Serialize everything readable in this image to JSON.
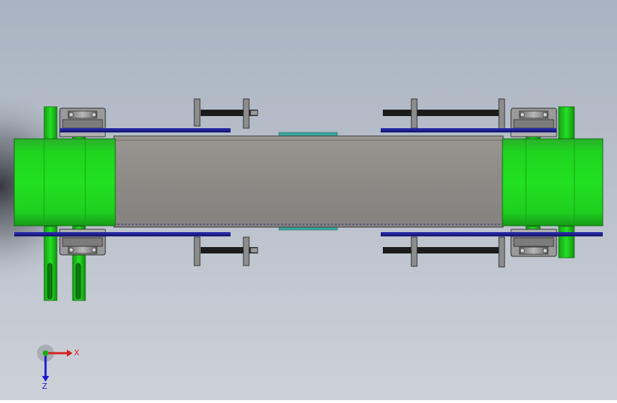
{
  "view": {
    "background_top": "#aab4c2",
    "background_bottom": "#c9ced6",
    "background_left_shadow": "#3c3f44"
  },
  "model": {
    "belt_color": "#8c8a87",
    "roller_color": "#1fd21f",
    "rail_color": "#1b1d8a",
    "shaft_color": "#7d7d7d",
    "screw_color": "#1c1c1c"
  },
  "triad": {
    "x_label": "X",
    "z_label": "Z",
    "x_color": "#d42020",
    "y_color": "#18b018",
    "z_color": "#1a1ad0"
  }
}
